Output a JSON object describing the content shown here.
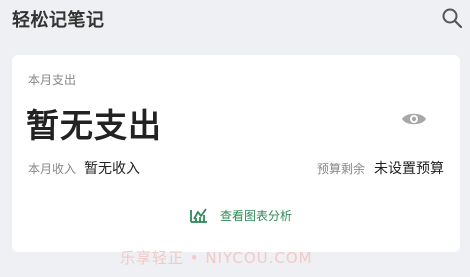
{
  "app": {
    "title": "轻松记笔记"
  },
  "icons": {
    "search": "search-icon",
    "eye": "eye-icon",
    "chart": "chart-analysis-icon"
  },
  "summary": {
    "month_label": "本月支出",
    "expense_value": "暂无支出",
    "income_label": "本月收入",
    "income_value": "暂无收入",
    "budget_label": "预算剩余",
    "budget_value": "未设置预算"
  },
  "actions": {
    "view_chart_label": "查看图表分析"
  },
  "watermark": {
    "text": "乐享轻正 • NIYCOU.COM"
  },
  "colors": {
    "accent": "#2e8b57",
    "background": "#eef0f3",
    "card": "#ffffff"
  }
}
